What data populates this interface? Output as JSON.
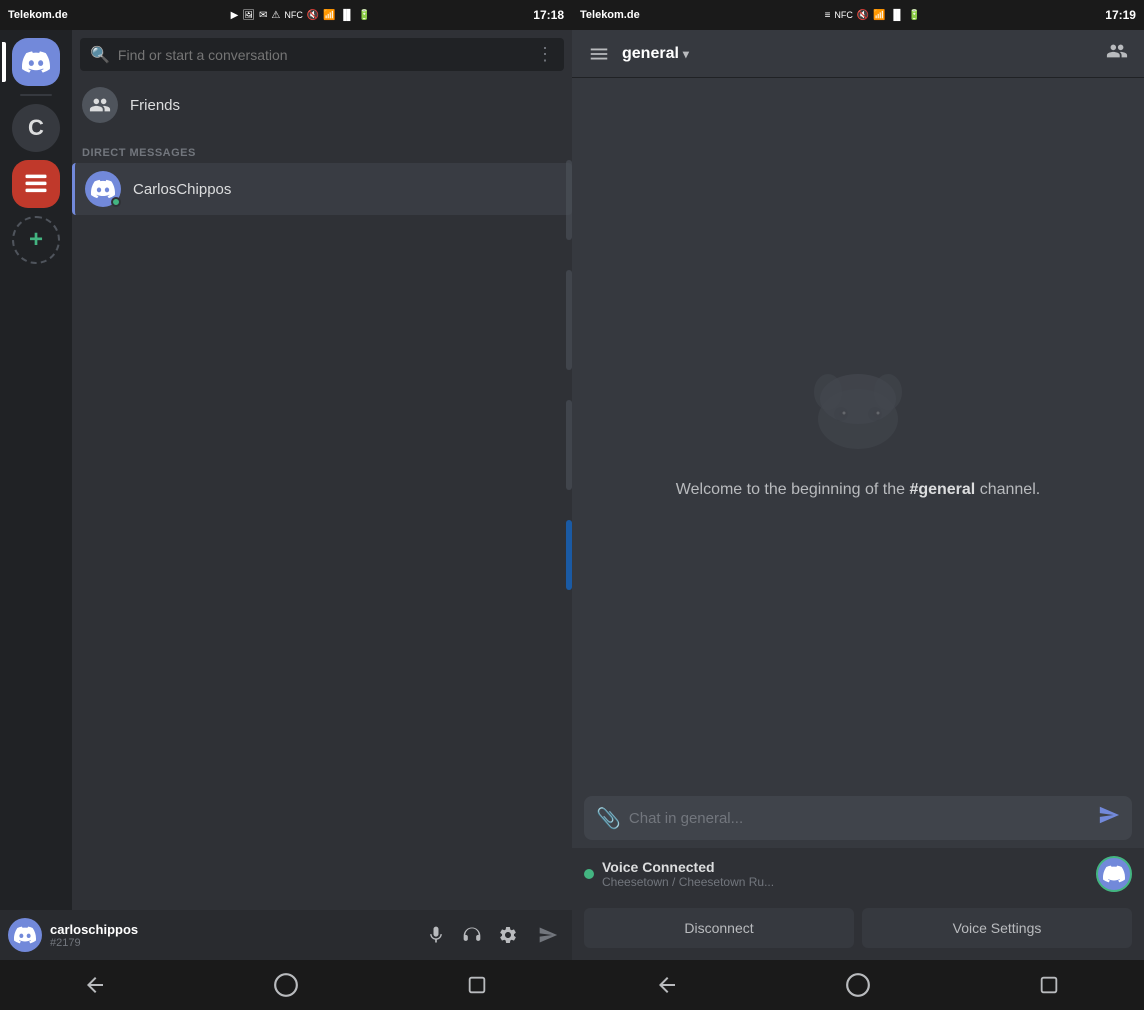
{
  "status_bar": {
    "left": {
      "carrier": "Telekom.de",
      "time": "17:18"
    },
    "right": {
      "carrier": "Telekom.de",
      "time": "17:19"
    }
  },
  "left_panel": {
    "search": {
      "placeholder": "Find or start a conversation"
    },
    "friends_label": "Friends",
    "dm_section_header": "DIRECT MESSAGES",
    "dm_users": [
      {
        "name": "CarlosChippos",
        "online": true
      }
    ],
    "bottom_user": {
      "name": "carloschippos",
      "tag": "#2179"
    }
  },
  "right_panel": {
    "channel_name": "general",
    "welcome_text_prefix": "Welcome to the beginning of the ",
    "channel_bold": "#general",
    "welcome_text_suffix": " channel.",
    "chat_placeholder": "Chat in general...",
    "voice": {
      "status": "Voice Connected",
      "channel": "Cheesetown / Cheesetown Ru...",
      "disconnect_label": "Disconnect",
      "settings_label": "Voice Settings"
    }
  },
  "bottom_nav": {
    "left": {
      "back": "◁",
      "home": "○",
      "square": "□"
    },
    "right": {
      "back": "◁",
      "home": "○",
      "square": "□"
    }
  }
}
